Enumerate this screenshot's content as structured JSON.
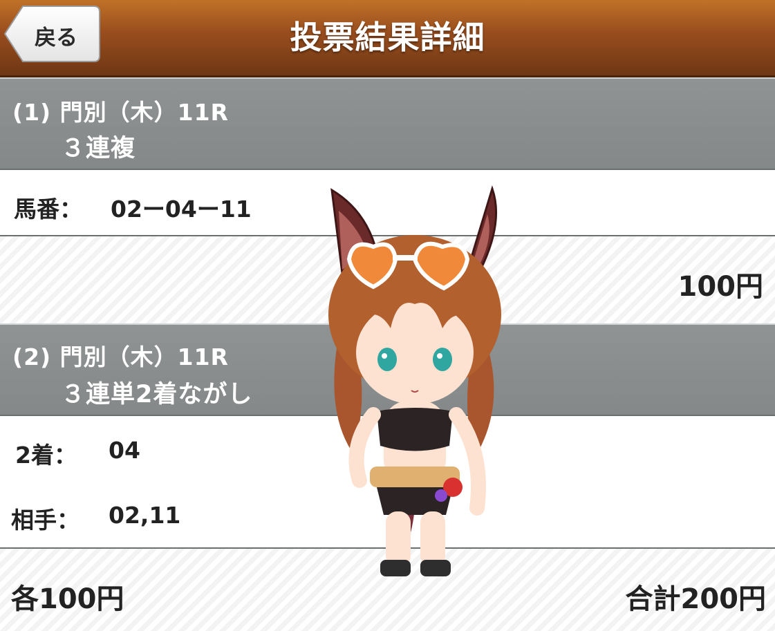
{
  "header": {
    "back_label": "戻る",
    "title": "投票結果詳細"
  },
  "bets": [
    {
      "race": "(1) 門別（木）11R",
      "kind": "３連複",
      "rows": [
        {
          "label": "馬番：",
          "value": "02ー04ー11"
        }
      ],
      "amount": "100円"
    },
    {
      "race": "(2) 門別（木）11R",
      "kind": "３連単2着ながし",
      "rows": [
        {
          "label": "2着：",
          "value": "04"
        },
        {
          "label": "相手：",
          "value": "02,11"
        }
      ],
      "each": "各100円",
      "total": "合計200円"
    }
  ]
}
